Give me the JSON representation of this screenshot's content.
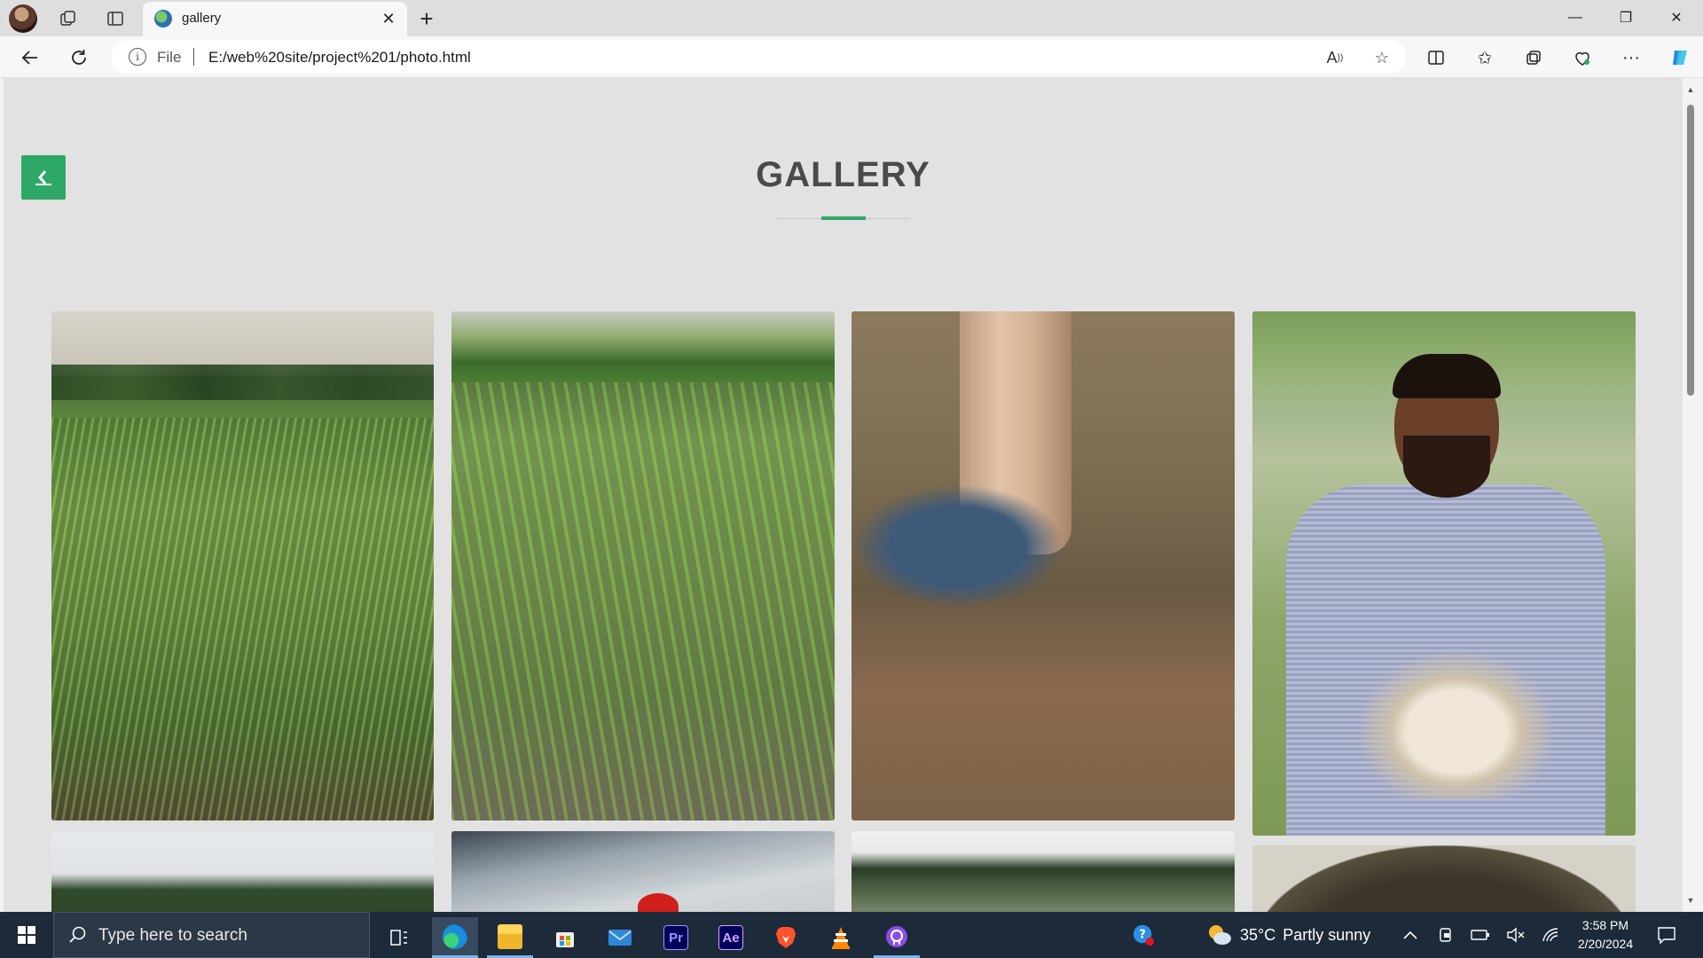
{
  "browser": {
    "tab_title": "gallery",
    "tab_close": "✕",
    "new_tab": "+",
    "address": {
      "scheme_label": "File",
      "url": "E:/web%20site/project%201/photo.html"
    },
    "window_controls": {
      "minimize": "—",
      "maximize": "❐",
      "close": "✕"
    }
  },
  "page": {
    "title": "GALLERY",
    "back_glyph": "<",
    "accent_color": "#2ea866",
    "photos": [
      {
        "subject": "rice paddy field at dusk"
      },
      {
        "subject": "rows of rice seedlings in water"
      },
      {
        "subject": "drip irrigation at palm tree base"
      },
      {
        "subject": "farmer holding harvested radishes"
      },
      {
        "subject": "trees under cloudy sky"
      },
      {
        "subject": "tin roof shed"
      },
      {
        "subject": "field with palm trees"
      },
      {
        "subject": "earthworms in compost"
      }
    ]
  },
  "taskbar": {
    "search_placeholder": "Type here to search",
    "apps": [
      {
        "name": "Edge",
        "label": ""
      },
      {
        "name": "File Explorer",
        "label": ""
      },
      {
        "name": "Microsoft Store",
        "label": ""
      },
      {
        "name": "Mail",
        "label": ""
      },
      {
        "name": "Premiere Pro",
        "label": "Pr"
      },
      {
        "name": "After Effects",
        "label": "Ae"
      },
      {
        "name": "Brave",
        "label": ""
      },
      {
        "name": "VLC",
        "label": ""
      },
      {
        "name": "GitHub Desktop",
        "label": ""
      }
    ],
    "weather": {
      "temp": "35°C",
      "condition": "Partly sunny"
    },
    "clock": {
      "time": "3:58 PM",
      "date": "2/20/2024"
    }
  }
}
